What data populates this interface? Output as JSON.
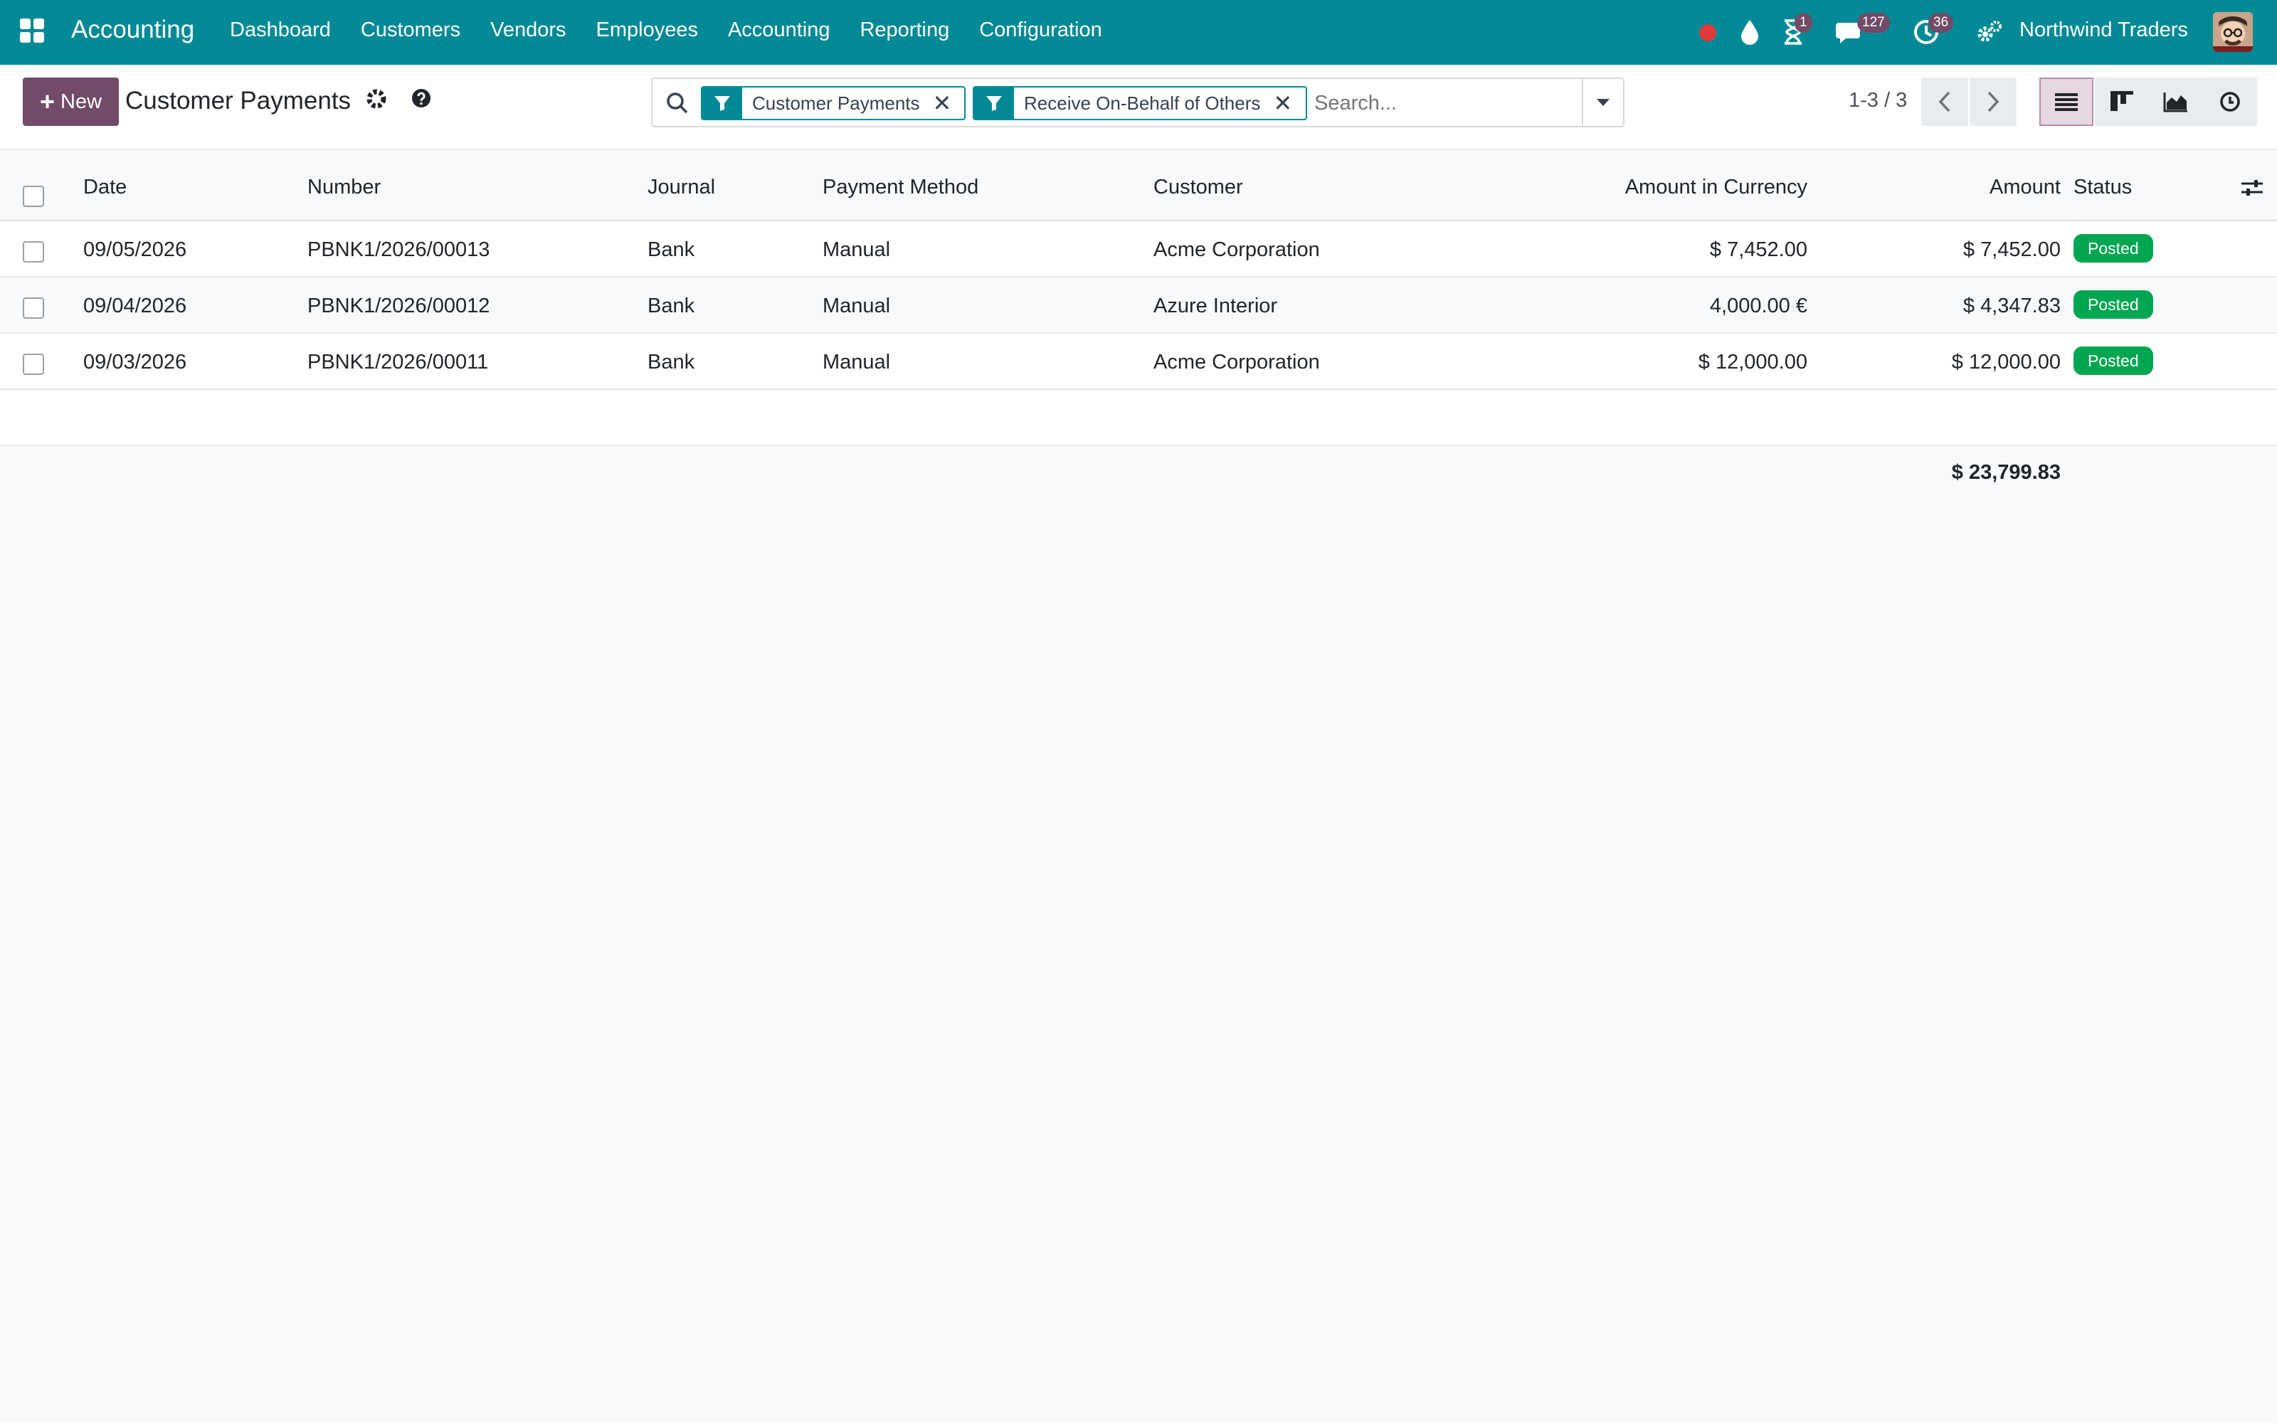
{
  "navbar": {
    "app_name": "Accounting",
    "menu": [
      "Dashboard",
      "Customers",
      "Vendors",
      "Employees",
      "Accounting",
      "Reporting",
      "Configuration"
    ],
    "badges": {
      "activities": "1",
      "messages": "127",
      "timer": "36"
    },
    "company": "Northwind Traders",
    "accent": "#018a96"
  },
  "control": {
    "new_label": "New",
    "title": "Customer Payments",
    "facets": [
      "Customer Payments",
      "Receive On-Behalf of Others"
    ],
    "search_placeholder": "Search...",
    "pager": "1-3 / 3"
  },
  "table": {
    "headers": {
      "date": "Date",
      "number": "Number",
      "journal": "Journal",
      "method": "Payment Method",
      "customer": "Customer",
      "amount_currency": "Amount in Currency",
      "amount": "Amount",
      "status": "Status"
    },
    "rows": [
      {
        "date": "09/05/2026",
        "number": "PBNK1/2026/00013",
        "journal": "Bank",
        "method": "Manual",
        "customer": "Acme Corporation",
        "amount_currency": "$ 7,452.00",
        "amount": "$ 7,452.00",
        "status": "Posted"
      },
      {
        "date": "09/04/2026",
        "number": "PBNK1/2026/00012",
        "journal": "Bank",
        "method": "Manual",
        "customer": "Azure Interior",
        "amount_currency": "4,000.00 €",
        "amount": "$ 4,347.83",
        "status": "Posted"
      },
      {
        "date": "09/03/2026",
        "number": "PBNK1/2026/00011",
        "journal": "Bank",
        "method": "Manual",
        "customer": "Acme Corporation",
        "amount_currency": "$ 12,000.00",
        "amount": "$ 12,000.00",
        "status": "Posted"
      }
    ],
    "total_amount": "$ 23,799.83"
  }
}
